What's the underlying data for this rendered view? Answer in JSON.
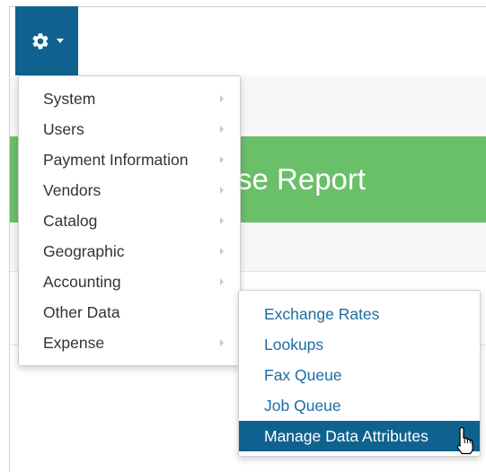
{
  "toolbar": {
    "settings_icon": "gear-icon",
    "dropdown_icon": "caret-down-icon",
    "accent_color": "#0f628f"
  },
  "page": {
    "banner_text": "se Report",
    "banner_color": "#6abf69"
  },
  "settings_menu": {
    "items": [
      {
        "label": "System",
        "has_submenu": true
      },
      {
        "label": "Users",
        "has_submenu": true
      },
      {
        "label": "Payment Information",
        "has_submenu": true
      },
      {
        "label": "Vendors",
        "has_submenu": true
      },
      {
        "label": "Catalog",
        "has_submenu": true
      },
      {
        "label": "Geographic",
        "has_submenu": true
      },
      {
        "label": "Accounting",
        "has_submenu": true
      },
      {
        "label": "Other Data",
        "has_submenu": false
      },
      {
        "label": "Expense",
        "has_submenu": true
      }
    ]
  },
  "other_data_submenu": {
    "items": [
      {
        "label": "Exchange Rates"
      },
      {
        "label": "Lookups"
      },
      {
        "label": "Fax Queue"
      },
      {
        "label": "Job Queue"
      },
      {
        "label": "Manage Data Attributes",
        "active": true
      }
    ],
    "link_color": "#1c6ea4",
    "active_color": "#0f628f"
  }
}
